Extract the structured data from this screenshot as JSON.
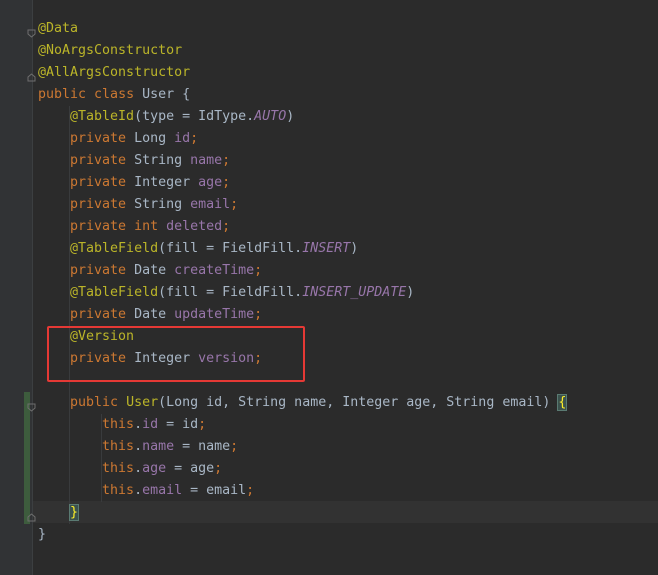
{
  "editor": {
    "lines": [
      [
        {
          "t": "@Data",
          "c": "ann"
        }
      ],
      [
        {
          "t": "@NoArgsConstructor",
          "c": "ann"
        }
      ],
      [
        {
          "t": "@AllArgsConstructor",
          "c": "ann"
        }
      ],
      [
        {
          "t": "public ",
          "c": "kw"
        },
        {
          "t": "class ",
          "c": "kw"
        },
        {
          "t": "User {",
          "c": "plain"
        }
      ],
      [
        {
          "t": "    @TableId",
          "c": "ann"
        },
        {
          "t": "(type = IdType.",
          "c": "plain"
        },
        {
          "t": "AUTO",
          "c": "const"
        },
        {
          "t": ")",
          "c": "plain"
        }
      ],
      [
        {
          "t": "    private ",
          "c": "kw"
        },
        {
          "t": "Long ",
          "c": "type"
        },
        {
          "t": "id",
          "c": "field"
        },
        {
          "t": ";",
          "c": "kw"
        }
      ],
      [
        {
          "t": "    private ",
          "c": "kw"
        },
        {
          "t": "String ",
          "c": "type"
        },
        {
          "t": "name",
          "c": "field"
        },
        {
          "t": ";",
          "c": "kw"
        }
      ],
      [
        {
          "t": "    private ",
          "c": "kw"
        },
        {
          "t": "Integer ",
          "c": "type"
        },
        {
          "t": "age",
          "c": "field"
        },
        {
          "t": ";",
          "c": "kw"
        }
      ],
      [
        {
          "t": "    private ",
          "c": "kw"
        },
        {
          "t": "String ",
          "c": "type"
        },
        {
          "t": "email",
          "c": "field"
        },
        {
          "t": ";",
          "c": "kw"
        }
      ],
      [
        {
          "t": "    private ",
          "c": "kw"
        },
        {
          "t": "int ",
          "c": "kw"
        },
        {
          "t": "deleted",
          "c": "field"
        },
        {
          "t": ";",
          "c": "kw"
        }
      ],
      [
        {
          "t": "    @TableField",
          "c": "ann"
        },
        {
          "t": "(fill = FieldFill.",
          "c": "plain"
        },
        {
          "t": "INSERT",
          "c": "const"
        },
        {
          "t": ")",
          "c": "plain"
        }
      ],
      [
        {
          "t": "    private ",
          "c": "kw"
        },
        {
          "t": "Date ",
          "c": "type"
        },
        {
          "t": "createTime",
          "c": "field"
        },
        {
          "t": ";",
          "c": "kw"
        }
      ],
      [
        {
          "t": "    @TableField",
          "c": "ann"
        },
        {
          "t": "(fill = FieldFill.",
          "c": "plain"
        },
        {
          "t": "INSERT_UPDATE",
          "c": "const"
        },
        {
          "t": ")",
          "c": "plain"
        }
      ],
      [
        {
          "t": "    private ",
          "c": "kw"
        },
        {
          "t": "Date ",
          "c": "type"
        },
        {
          "t": "updateTime",
          "c": "field"
        },
        {
          "t": ";",
          "c": "kw"
        }
      ],
      [
        {
          "t": "    @Version",
          "c": "ann"
        }
      ],
      [
        {
          "t": "    private ",
          "c": "kw"
        },
        {
          "t": "Integer ",
          "c": "type"
        },
        {
          "t": "version",
          "c": "field"
        },
        {
          "t": ";",
          "c": "kw"
        }
      ],
      [],
      [
        {
          "t": "    public ",
          "c": "kw"
        },
        {
          "t": "User",
          "c": "ann"
        },
        {
          "t": "(Long id, String name, Integer age, String email) ",
          "c": "plain"
        },
        {
          "t": "{",
          "c": "brace-match"
        }
      ],
      [
        {
          "t": "        this",
          "c": "kw"
        },
        {
          "t": ".",
          "c": "plain"
        },
        {
          "t": "id",
          "c": "field"
        },
        {
          "t": " = id",
          "c": "plain"
        },
        {
          "t": ";",
          "c": "kw"
        }
      ],
      [
        {
          "t": "        this",
          "c": "kw"
        },
        {
          "t": ".",
          "c": "plain"
        },
        {
          "t": "name",
          "c": "field"
        },
        {
          "t": " = name",
          "c": "plain"
        },
        {
          "t": ";",
          "c": "kw"
        }
      ],
      [
        {
          "t": "        this",
          "c": "kw"
        },
        {
          "t": ".",
          "c": "plain"
        },
        {
          "t": "age",
          "c": "field"
        },
        {
          "t": " = age",
          "c": "plain"
        },
        {
          "t": ";",
          "c": "kw"
        }
      ],
      [
        {
          "t": "        this",
          "c": "kw"
        },
        {
          "t": ".",
          "c": "plain"
        },
        {
          "t": "email",
          "c": "field"
        },
        {
          "t": " = email",
          "c": "plain"
        },
        {
          "t": ";",
          "c": "kw"
        }
      ],
      [
        {
          "t": "    ",
          "c": "plain"
        },
        {
          "t": "}",
          "c": "brace-match"
        }
      ],
      [
        {
          "t": "}",
          "c": "plain"
        }
      ]
    ],
    "highlight_label": "highlighted-version-field",
    "colors": {
      "background": "#2b2b2b",
      "annotation": "#bbb529",
      "keyword": "#cc7832",
      "field": "#9876aa",
      "plain": "#a9b7c6",
      "highlight_box": "#e53935"
    }
  }
}
